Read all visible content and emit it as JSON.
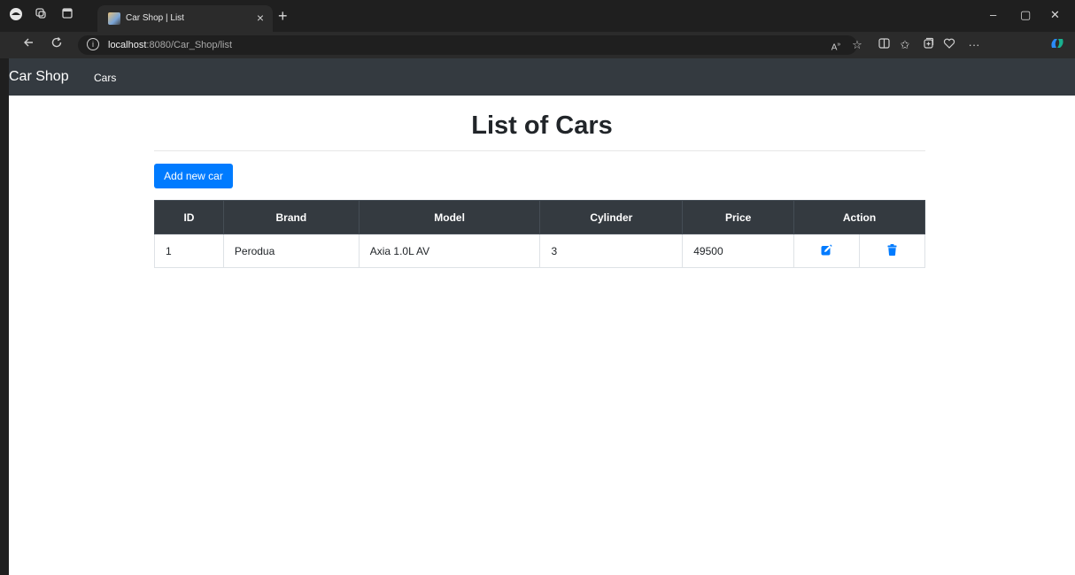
{
  "browser": {
    "tab_title": "Car Shop | List",
    "tab_close": "×",
    "new_tab": "+",
    "url_host": "localhost",
    "url_path": ":8080/Car_Shop/list",
    "url_info": "i",
    "window_controls": {
      "minimize": "–",
      "restore": "▢",
      "close": "✕"
    },
    "toolbar_more": "···"
  },
  "navbar": {
    "brand": "Car Shop",
    "links": [
      "Cars"
    ]
  },
  "page": {
    "title": "List of Cars",
    "add_button": "Add new car"
  },
  "table": {
    "headers": [
      "ID",
      "Brand",
      "Model",
      "Cylinder",
      "Price",
      "Action"
    ],
    "rows": [
      {
        "id": "1",
        "brand": "Perodua",
        "model": "Axia 1.0L AV",
        "cylinder": "3",
        "price": "49500",
        "actions": [
          "edit-icon",
          "trash-icon"
        ]
      }
    ]
  },
  "colors": {
    "navbar_bg": "#343a40",
    "primary": "#007bff",
    "table_header_bg": "#343a40"
  }
}
